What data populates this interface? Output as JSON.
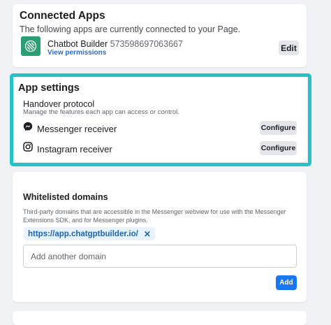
{
  "connected_apps": {
    "title": "Connected Apps",
    "description": "The following apps are currently connected to your Page.",
    "app": {
      "name": "Chatbot Builder",
      "id": "573598697063667",
      "view_permissions": "View permissions",
      "edit_label": "Edit",
      "logo_color": "#2c9e74"
    }
  },
  "app_settings": {
    "title": "App settings",
    "handover_title": "Handover protocol",
    "handover_description": "Manage the features each app can access or control.",
    "receivers": [
      {
        "label": "Messenger receiver",
        "icon": "messenger-icon",
        "button": "Configure"
      },
      {
        "label": "Instagram receiver",
        "icon": "instagram-icon",
        "button": "Configure"
      }
    ],
    "highlight_color": "#23c3c7"
  },
  "whitelisted_domains": {
    "title": "Whitelisted domains",
    "description": "Third-party domains that are accessible in the Messenger webview for use with the Messenger Extensions SDK, and for Messenger plugins.",
    "domains": [
      "https://app.chatgptbuilder.io/"
    ],
    "input_placeholder": "Add another domain",
    "add_label": "Add",
    "accent_color": "#1877f2"
  }
}
